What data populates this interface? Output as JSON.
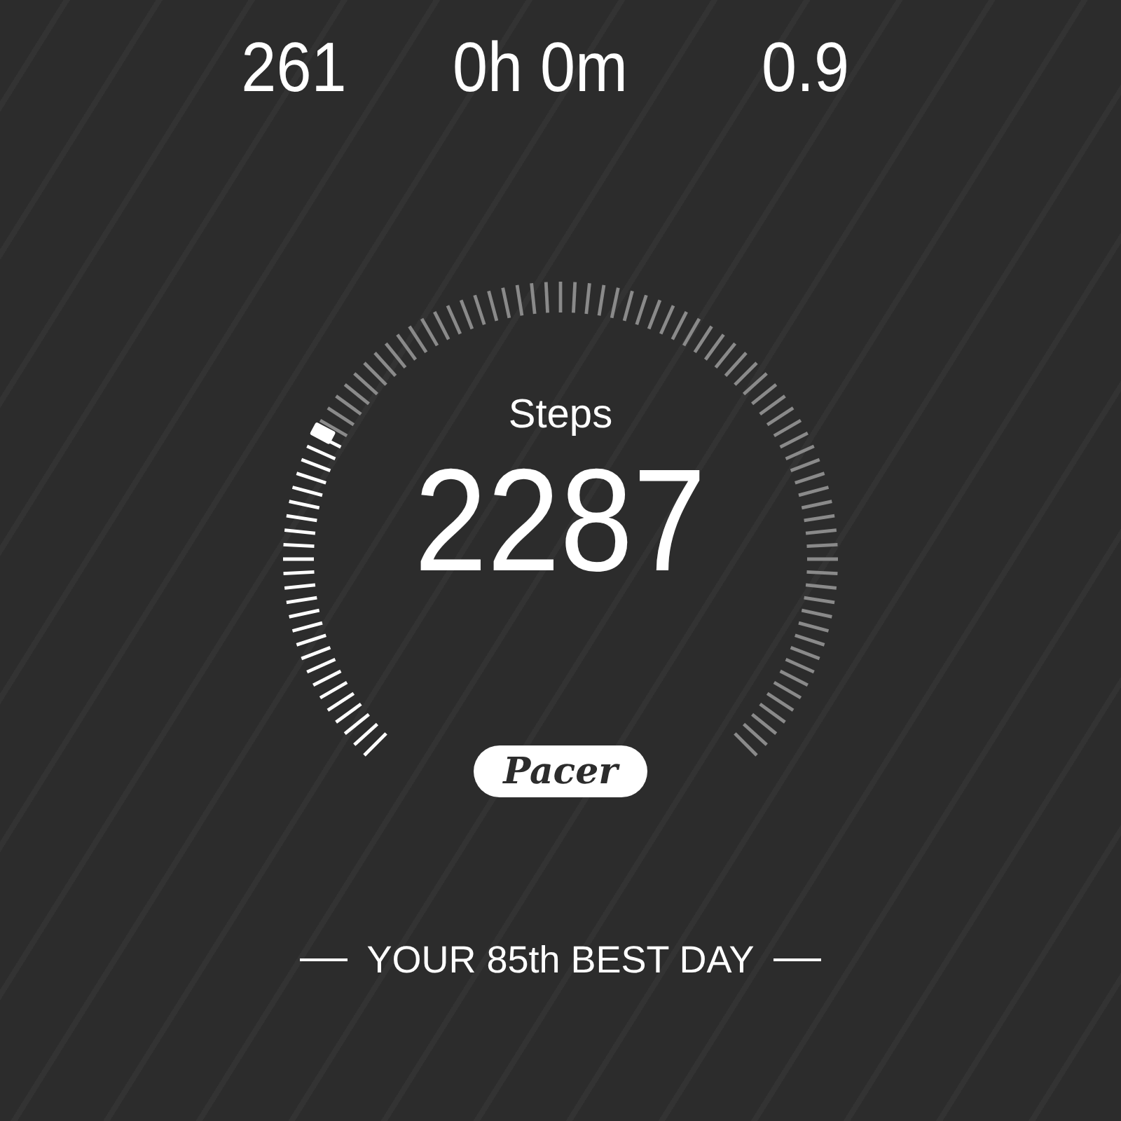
{
  "stats": [
    {
      "value": "261"
    },
    {
      "value": "0h 0m"
    },
    {
      "value": "0.9"
    }
  ],
  "steps": {
    "label": "Steps",
    "value": "2287"
  },
  "badge": {
    "text": "Pacer"
  },
  "footer": {
    "text": "YOUR 85th BEST DAY"
  }
}
